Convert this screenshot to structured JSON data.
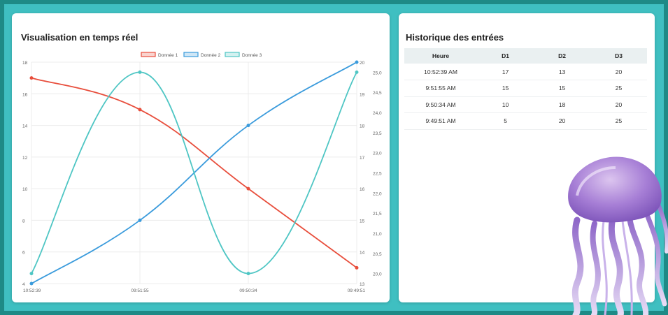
{
  "colors": {
    "background": "#3fbfc1",
    "series1": "#e84e3c",
    "series2": "#3a9bdc",
    "series3": "#4fc6c4"
  },
  "chart_card": {
    "title": "Visualisation en temps réel"
  },
  "table_card": {
    "title": "Historique des entrées",
    "columns": [
      "Heure",
      "D1",
      "D2",
      "D3"
    ],
    "rows": [
      [
        "10:52:39 AM",
        "17",
        "13",
        "20"
      ],
      [
        "9:51:55 AM",
        "15",
        "15",
        "25"
      ],
      [
        "9:50:34 AM",
        "10",
        "18",
        "20"
      ],
      [
        "9:49:51 AM",
        "5",
        "20",
        "25"
      ]
    ]
  },
  "decoration": {
    "icon": "jellyfish-illustration"
  },
  "chart_data": {
    "type": "line",
    "title": "",
    "categories": [
      "10:52:39",
      "09:51:55",
      "09:50:34",
      "09:49:51"
    ],
    "series": [
      {
        "name": "Donnée 1",
        "values": [
          17,
          15,
          10,
          5
        ],
        "axis": "y1",
        "color": "#e84e3c"
      },
      {
        "name": "Donnée 2",
        "values": [
          13,
          15,
          18,
          20
        ],
        "axis": "y2",
        "color": "#3a9bdc"
      },
      {
        "name": "Donnée 3",
        "values": [
          20,
          25,
          20,
          25
        ],
        "axis": "y3",
        "color": "#4fc6c4"
      }
    ],
    "y1": {
      "min": 4,
      "max": 18,
      "ticks": [
        "4",
        "6",
        "8",
        "10",
        "12",
        "14",
        "16",
        "18"
      ]
    },
    "y2": {
      "min": 13,
      "max": 20,
      "ticks": [
        "13",
        "14",
        "15",
        "16",
        "17",
        "18",
        "19",
        "20"
      ]
    },
    "y3": {
      "min": 19.75,
      "max": 25.25,
      "ticks": [
        "20,0",
        "20,5",
        "21,0",
        "21,5",
        "22,0",
        "22,5",
        "23,0",
        "23,5",
        "24,0",
        "24,5",
        "25,0"
      ]
    },
    "legend": "top-center",
    "grid": true
  }
}
